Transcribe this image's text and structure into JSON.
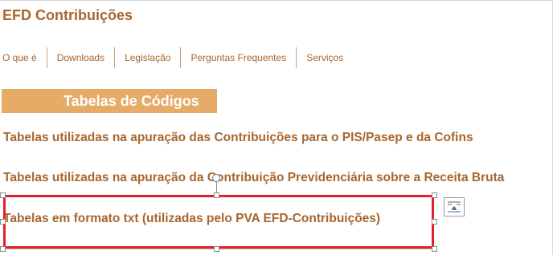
{
  "site": {
    "title": "EFD Contribuições"
  },
  "nav": {
    "items": [
      {
        "label": "O que é"
      },
      {
        "label": "Downloads"
      },
      {
        "label": "Legislação"
      },
      {
        "label": "Perguntas Frequentes"
      },
      {
        "label": "Serviços"
      }
    ]
  },
  "section": {
    "title": "Tabelas de Códigos"
  },
  "links": [
    {
      "text": "Tabelas utilizadas na apuração das Contribuições para o PIS/Pasep e da Cofins"
    },
    {
      "text": "Tabelas utilizadas na apuração da Contribuição Previdenciária sobre a Receita Bruta"
    },
    {
      "text": "Tabelas em formato txt (utilizadas pelo PVA EFD-Contribuições)"
    }
  ],
  "icons": {
    "rotate": "rotate-handle-icon",
    "layout": "layout-options-icon"
  },
  "colors": {
    "brand_text": "#a8662e",
    "section_bg": "#e5ab67",
    "selection_border": "#e0202a"
  }
}
